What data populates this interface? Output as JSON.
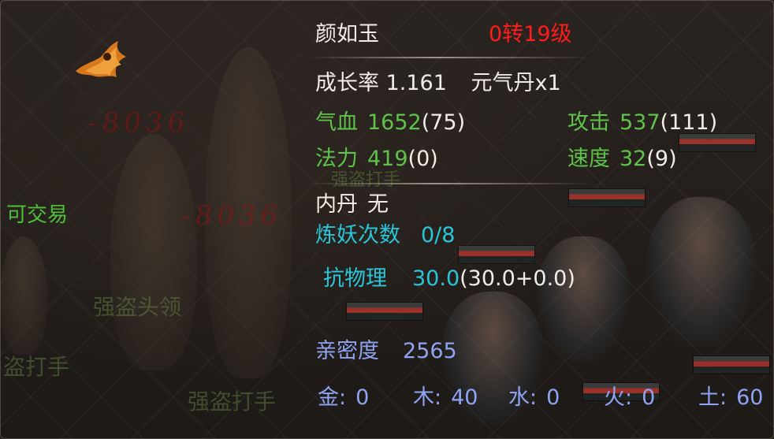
{
  "pet": {
    "name": "颜如玉",
    "level": "0转19级"
  },
  "growth": {
    "label": "成长率",
    "value": "1.161",
    "item": "元气丹x1"
  },
  "stats": {
    "hp": {
      "label": "气血",
      "value": "1652",
      "bonus": "(75)"
    },
    "attack": {
      "label": "攻击",
      "value": "537",
      "bonus": "(111)"
    },
    "mp": {
      "label": "法力",
      "value": "419",
      "bonus": "(0)"
    },
    "speed": {
      "label": "速度",
      "value": "32",
      "bonus": "(9)"
    }
  },
  "inner_core": {
    "label": "内丹",
    "value": "无"
  },
  "refine": {
    "label": "炼妖次数",
    "value": "0/8"
  },
  "resist": {
    "label": "抗物理",
    "value": "30.0",
    "detail": "(30.0+0.0)"
  },
  "intimacy": {
    "label": "亲密度",
    "value": "2565"
  },
  "elements": {
    "metal": {
      "label": "金:",
      "value": "0"
    },
    "wood": {
      "label": "木:",
      "value": "40"
    },
    "water": {
      "label": "水:",
      "value": "0"
    },
    "fire": {
      "label": "火:",
      "value": "0"
    },
    "earth": {
      "label": "土:",
      "value": "60"
    }
  },
  "scene": {
    "tradeable": "可交易",
    "ghost_damage_1": "-8036",
    "ghost_damage_2": "-8036",
    "ghost_name_1": "强盗头领",
    "ghost_name_2": "盗打手",
    "ghost_name_3": "强盗打手",
    "ghost_name_4": "强盗打手"
  },
  "colors": {
    "white": "#f2ede6",
    "red": "#ff1c1c",
    "green": "#5fc24a",
    "cyan": "#29c6da",
    "blue": "#8fa4f2"
  }
}
